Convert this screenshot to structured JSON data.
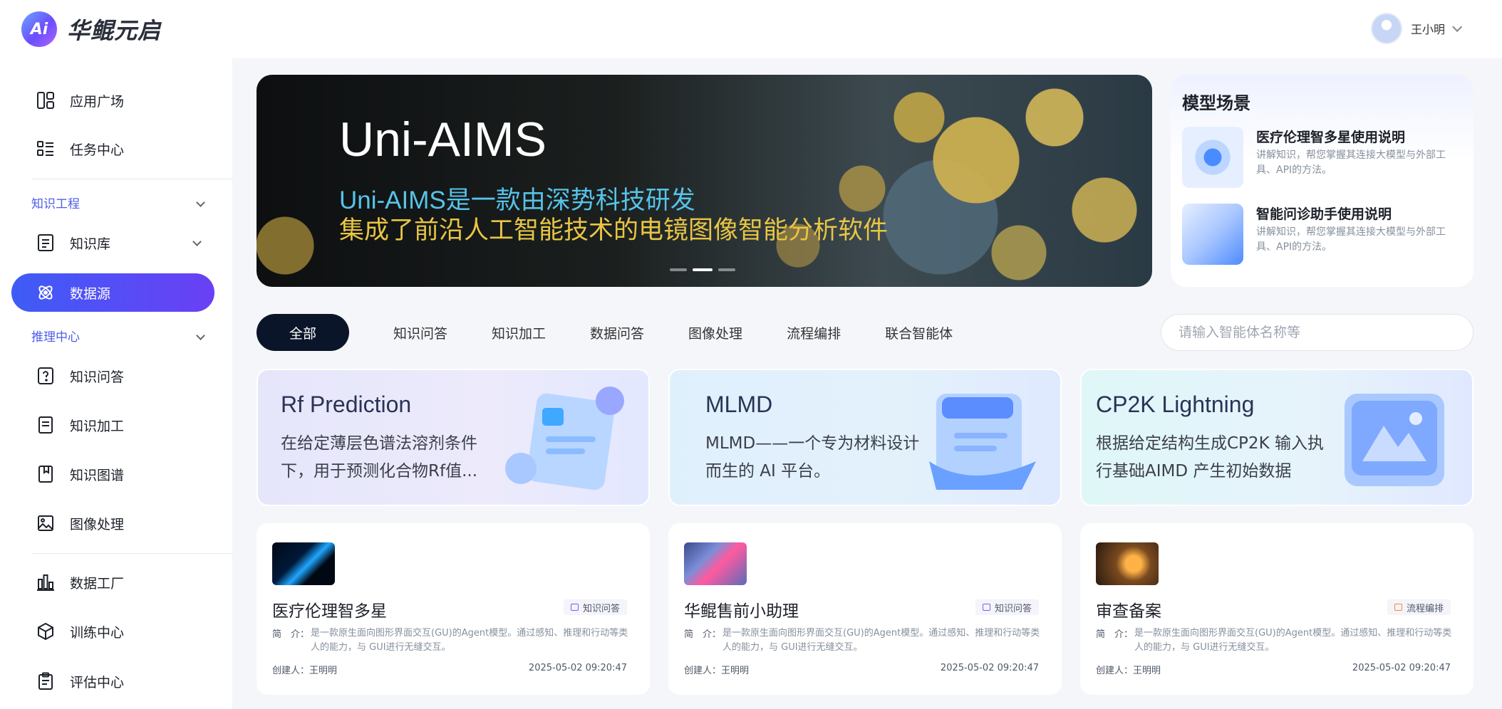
{
  "header": {
    "logo_mark": "Ai",
    "logo_text": "华鲲元启",
    "user_name": "王小明"
  },
  "sidebar": {
    "items_top": [
      {
        "label": "应用广场",
        "icon": "grid-apps-icon"
      },
      {
        "label": "任务中心",
        "icon": "list-icon"
      }
    ],
    "section_knowledge": "知识工程",
    "knowledge_items": [
      {
        "label": "知识库",
        "icon": "document-icon"
      },
      {
        "label": "数据源",
        "icon": "atom-icon"
      }
    ],
    "section_inference": "推理中心",
    "inference_items": [
      {
        "label": "知识问答",
        "icon": "question-icon"
      },
      {
        "label": "知识加工",
        "icon": "document-edit-icon"
      },
      {
        "label": "知识图谱",
        "icon": "bookmark-icon"
      },
      {
        "label": "图像处理",
        "icon": "image-icon"
      }
    ],
    "bottom_items": [
      {
        "label": "数据工厂",
        "icon": "bar-chart-icon"
      },
      {
        "label": "训练中心",
        "icon": "cube-icon"
      },
      {
        "label": "评估中心",
        "icon": "clipboard-icon"
      }
    ],
    "active": "数据源",
    "accent": "#4f52f7"
  },
  "banner": {
    "title": "Uni-AIMS",
    "line1": "Uni-AIMS是一款由深势科技研发",
    "line2": "集成了前沿人工智能技术的电镜图像智能分析软件",
    "slide_count": 3,
    "active_slide": 2
  },
  "scenes": {
    "title": "模型场景",
    "items": [
      {
        "title": "医疗伦理智多星使用说明",
        "desc": "讲解知识，帮您掌握其连接大模型与外部工具、API的方法。"
      },
      {
        "title": "智能问诊助手使用说明",
        "desc": "讲解知识，帮您掌握其连接大模型与外部工具、API的方法。"
      }
    ]
  },
  "tabs": [
    "全部",
    "知识问答",
    "知识加工",
    "数据问答",
    "图像处理",
    "流程编排",
    "联合智能体"
  ],
  "search": {
    "placeholder": "请输入智能体名称等"
  },
  "featured": [
    {
      "title": "Rf Prediction",
      "desc": "在给定薄层色谱法溶剂条件下，用于预测化合物Rf值..."
    },
    {
      "title": "MLMD",
      "desc": "MLMD——一个专为材料设计而生的 AI 平台。"
    },
    {
      "title": "CP2K Lightning",
      "desc": "根据给定结构生成CP2K 输入执行基础AIMD 产生初始数据"
    }
  ],
  "cards": [
    {
      "title": "医疗伦理智多星",
      "tag": "知识问答",
      "desc_label": "简　介：",
      "desc": "是一款原生面向图形界面交互(GU)的Agent模型。通过感知、推理和行动等类人的能力，与 GUI进行无缝交互。",
      "creator": "创建人：王明明",
      "time": "2025-05-02 09:20:47"
    },
    {
      "title": "华鲲售前小助理",
      "tag": "知识问答",
      "desc_label": "简　介：",
      "desc": "是一款原生面向图形界面交互(GU)的Agent模型。通过感知、推理和行动等类人的能力，与 GUI进行无缝交互。",
      "creator": "创建人：王明明",
      "time": "2025-05-02 09:20:47"
    },
    {
      "title": "审查备案",
      "tag": "流程编排",
      "desc_label": "简　介：",
      "desc": "是一款原生面向图形界面交互(GU)的Agent模型。通过感知、推理和行动等类人的能力，与 GUI进行无缝交互。",
      "creator": "创建人：王明明",
      "time": "2025-05-02 09:20:47"
    }
  ]
}
